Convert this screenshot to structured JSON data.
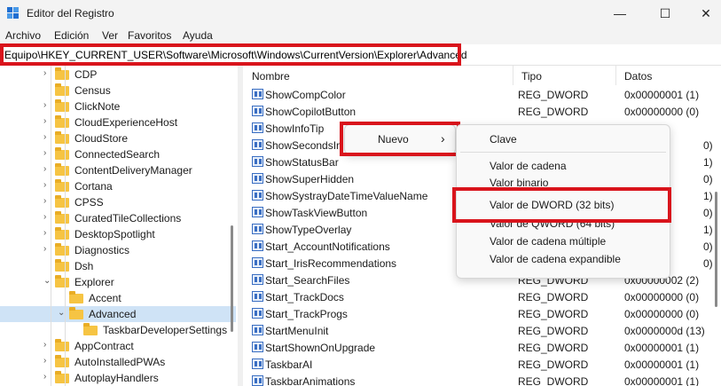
{
  "window": {
    "title": "Editor del Registro",
    "minimize": "—",
    "maximize": "☐",
    "close": "✕"
  },
  "menu": [
    "Archivo",
    "Edición",
    "Ver",
    "Favoritos",
    "Ayuda"
  ],
  "address": "Equipo\\HKEY_CURRENT_USER\\Software\\Microsoft\\Windows\\CurrentVersion\\Explorer\\Advanced",
  "tree": {
    "items": [
      {
        "label": "CDP",
        "chevron": "›"
      },
      {
        "label": "Census",
        "chevron": ""
      },
      {
        "label": "ClickNote",
        "chevron": "›"
      },
      {
        "label": "CloudExperienceHost",
        "chevron": "›"
      },
      {
        "label": "CloudStore",
        "chevron": "›"
      },
      {
        "label": "ConnectedSearch",
        "chevron": "›"
      },
      {
        "label": "ContentDeliveryManager",
        "chevron": "›"
      },
      {
        "label": "Cortana",
        "chevron": "›"
      },
      {
        "label": "CPSS",
        "chevron": "›"
      },
      {
        "label": "CuratedTileCollections",
        "chevron": "›"
      },
      {
        "label": "DesktopSpotlight",
        "chevron": "›"
      },
      {
        "label": "Diagnostics",
        "chevron": "›"
      },
      {
        "label": "Dsh",
        "chevron": ""
      },
      {
        "label": "Explorer",
        "chevron": "⌄"
      },
      {
        "label": "Accent",
        "chevron": ""
      },
      {
        "label": "Advanced",
        "chevron": "⌄"
      },
      {
        "label": "TaskbarDeveloperSettings",
        "chevron": ""
      },
      {
        "label": "AppContract",
        "chevron": "›"
      },
      {
        "label": "AutoInstalledPWAs",
        "chevron": "›"
      },
      {
        "label": "AutoplayHandlers",
        "chevron": "›"
      }
    ]
  },
  "columns": {
    "name": "Nombre",
    "type": "Tipo",
    "data": "Datos"
  },
  "values": [
    {
      "name": "ShowCompColor",
      "type": "REG_DWORD",
      "data": "0x00000001 (1)"
    },
    {
      "name": "ShowCopilotButton",
      "type": "REG_DWORD",
      "data": "0x00000000 (0)"
    },
    {
      "name": "ShowInfoTip",
      "type": "",
      "data": ""
    },
    {
      "name": "ShowSecondsIn",
      "type": "",
      "data": "0)"
    },
    {
      "name": "ShowStatusBar",
      "type": "",
      "data": "1)"
    },
    {
      "name": "ShowSuperHidden",
      "type": "",
      "data": "0)"
    },
    {
      "name": "ShowSystrayDateTimeValueName",
      "type": "",
      "data": "1)"
    },
    {
      "name": "ShowTaskViewButton",
      "type": "",
      "data": "0)"
    },
    {
      "name": "ShowTypeOverlay",
      "type": "",
      "data": "1)"
    },
    {
      "name": "Start_AccountNotifications",
      "type": "",
      "data": "0)"
    },
    {
      "name": "Start_IrisRecommendations",
      "type": "",
      "data": "0)"
    },
    {
      "name": "Start_SearchFiles",
      "type": "REG_DWORD",
      "data": "0x00000002 (2)"
    },
    {
      "name": "Start_TrackDocs",
      "type": "REG_DWORD",
      "data": "0x00000000 (0)"
    },
    {
      "name": "Start_TrackProgs",
      "type": "REG_DWORD",
      "data": "0x00000000 (0)"
    },
    {
      "name": "StartMenuInit",
      "type": "REG_DWORD",
      "data": "0x0000000d (13)"
    },
    {
      "name": "StartShownOnUpgrade",
      "type": "REG_DWORD",
      "data": "0x00000001 (1)"
    },
    {
      "name": "TaskbarAI",
      "type": "REG_DWORD",
      "data": "0x00000001 (1)"
    },
    {
      "name": "TaskbarAnimations",
      "type": "REG_DWORD",
      "data": "0x00000001 (1)"
    }
  ],
  "context_menu": {
    "nuevo": "Nuevo",
    "arrow": "›"
  },
  "submenu": {
    "items": [
      "Clave",
      "Valor de cadena",
      "Valor binario",
      "Valor de DWORD (32 bits)",
      "Valor de QWORD (64 bits)",
      "Valor de cadena múltiple",
      "Valor de cadena expandible"
    ]
  },
  "colors": {
    "highlight": "#d9141c",
    "folder": "#f6c443",
    "selected": "#cfe3f6"
  }
}
